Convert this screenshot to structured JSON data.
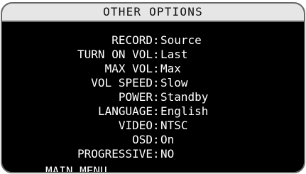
{
  "title": "OTHER OPTIONS",
  "options": [
    {
      "label": "RECORD",
      "value": "Source"
    },
    {
      "label": "TURN ON VOL",
      "value": "Last"
    },
    {
      "label": "MAX VOL",
      "value": "Max"
    },
    {
      "label": "VOL SPEED",
      "value": "Slow"
    },
    {
      "label": "POWER",
      "value": "Standby"
    },
    {
      "label": "LANGUAGE",
      "value": "English"
    },
    {
      "label": "VIDEO",
      "value": "NTSC"
    },
    {
      "label": "OSD",
      "value": "On"
    },
    {
      "label": "PROGRESSIVE",
      "value": "NO"
    }
  ],
  "menu": {
    "label": "MAIN MENU"
  },
  "colors": {
    "title_bg": "#e6e6e6",
    "screen_bg": "#000000",
    "text": "#ffffff",
    "border": "#6a6a6a"
  }
}
